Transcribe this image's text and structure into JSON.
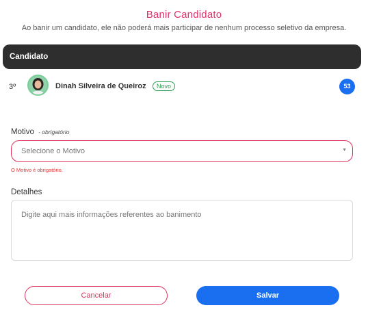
{
  "dialog": {
    "title": "Banir Candidato",
    "subtitle": "Ao banir um candidato, ele não poderá mais participar de nenhum processo seletivo da empresa."
  },
  "table": {
    "header": "Candidato"
  },
  "candidate": {
    "rank": "3º",
    "name": "Dinah Silveira de Queiroz",
    "badge": "Novo",
    "score": "53"
  },
  "form": {
    "motivo_label": "Motivo",
    "motivo_required": "- obrigatório",
    "motivo_placeholder": "Selecione o Motivo",
    "motivo_error": "O Motivo é obrigatório.",
    "detalhes_label": "Detalhes",
    "detalhes_placeholder": "Digite aqui mais informações referentes ao banimento"
  },
  "actions": {
    "cancel_label": "Cancelar",
    "save_label": "Salvar"
  },
  "colors": {
    "accent_pink": "#e0306a",
    "primary_blue": "#1a6ef0",
    "header_dark": "#2e2e2e",
    "success_green": "#2a9d4f"
  },
  "icons": {
    "select_caret": "chevron-down-icon",
    "avatar": "user-avatar"
  }
}
